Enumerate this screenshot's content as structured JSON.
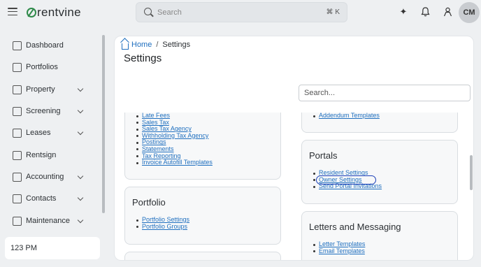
{
  "app": {
    "logo_text": "rentvine"
  },
  "search": {
    "placeholder": "Search",
    "shortcut": "⌘ K"
  },
  "topbar": {
    "avatar_initials": "CM"
  },
  "sidebar": {
    "items": [
      {
        "label": "Dashboard",
        "icon": "grid-icon",
        "chevron": false
      },
      {
        "label": "Portfolios",
        "icon": "folders-icon",
        "chevron": false
      },
      {
        "label": "Property",
        "icon": "building-icon",
        "chevron": true
      },
      {
        "label": "Screening",
        "icon": "screening-icon",
        "chevron": true
      },
      {
        "label": "Leases",
        "icon": "clipboard-icon",
        "chevron": true
      },
      {
        "label": "Rentsign",
        "icon": "signature-icon",
        "chevron": false
      },
      {
        "label": "Accounting",
        "icon": "dollar-icon",
        "chevron": true
      },
      {
        "label": "Contacts",
        "icon": "book-icon",
        "chevron": true
      },
      {
        "label": "Maintenance",
        "icon": "wrench-icon",
        "chevron": true
      }
    ],
    "time": "123 PM"
  },
  "breadcrumb": {
    "home": "Home",
    "separator": "/",
    "current": "Settings"
  },
  "page": {
    "title": "Settings",
    "filter_placeholder": "Search..."
  },
  "cards": {
    "accounting": {
      "links": [
        "Late Fees",
        "Sales Tax",
        "Sales Tax Agency",
        "Withholding Tax Agency",
        "Postings",
        "Statements",
        "Tax Reporting",
        "Invoice Autofill Templates"
      ]
    },
    "leases": {
      "links": [
        "Addendum Templates"
      ]
    },
    "portfolio": {
      "title": "Portfolio",
      "links": [
        "Portfolio Settings",
        "Portfolio Groups"
      ]
    },
    "portals": {
      "title": "Portals",
      "links": [
        "Resident Settings",
        "Owner Settings",
        "Send Portal Invitations"
      ]
    },
    "letters": {
      "title": "Letters and Messaging",
      "links": [
        "Letter Templates",
        "Email Templates"
      ]
    }
  },
  "colors": {
    "link": "#1f6fbf",
    "highlight": "#1b3fb8",
    "brand": "#2f8a4a"
  }
}
